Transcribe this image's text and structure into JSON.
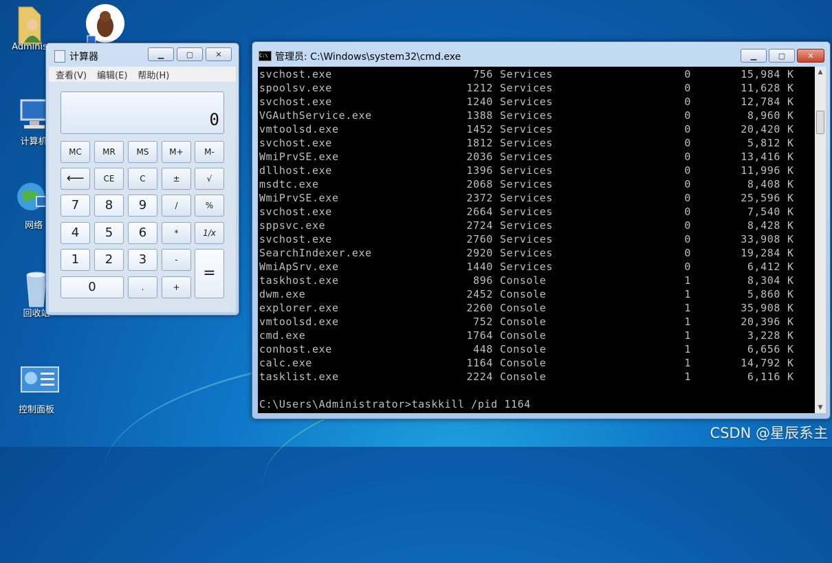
{
  "desktop": {
    "icons": [
      {
        "label": "Adminis",
        "icon": "user-folder-icon"
      },
      {
        "label": "",
        "icon": "beaver-app-icon"
      },
      {
        "label": "计算机",
        "icon": "computer-icon"
      },
      {
        "label": "网络",
        "icon": "network-icon"
      },
      {
        "label": "回收站",
        "icon": "recycle-bin-icon"
      },
      {
        "label": "控制面板",
        "icon": "control-panel-icon"
      }
    ],
    "watermark": "CSDN @星辰系主"
  },
  "calculator": {
    "title": "计算器",
    "menu": [
      "查看(V)",
      "编辑(E)",
      "帮助(H)"
    ],
    "display": "0",
    "keys": {
      "mc": "MC",
      "mr": "MR",
      "ms": "MS",
      "mplus": "M+",
      "mminus": "M-",
      "back": "⟵",
      "ce": "CE",
      "c": "C",
      "sign": "±",
      "sqrt": "√",
      "n7": "7",
      "n8": "8",
      "n9": "9",
      "div": "/",
      "pct": "%",
      "n4": "4",
      "n5": "5",
      "n6": "6",
      "mul": "*",
      "recip": "1/x",
      "n1": "1",
      "n2": "2",
      "n3": "3",
      "sub": "-",
      "eq": "=",
      "n0": "0",
      "dot": ".",
      "add": "+"
    }
  },
  "cmd": {
    "title": "管理员: C:\\Windows\\system32\\cmd.exe",
    "icon_text": "C:\\",
    "rows": [
      {
        "name": "svchost.exe",
        "pid": "756",
        "session": "Services",
        "num": "0",
        "mem": "15,984",
        "unit": "K"
      },
      {
        "name": "spoolsv.exe",
        "pid": "1212",
        "session": "Services",
        "num": "0",
        "mem": "11,628",
        "unit": "K"
      },
      {
        "name": "svchost.exe",
        "pid": "1240",
        "session": "Services",
        "num": "0",
        "mem": "12,784",
        "unit": "K"
      },
      {
        "name": "VGAuthService.exe",
        "pid": "1388",
        "session": "Services",
        "num": "0",
        "mem": "8,960",
        "unit": "K"
      },
      {
        "name": "vmtoolsd.exe",
        "pid": "1452",
        "session": "Services",
        "num": "0",
        "mem": "20,420",
        "unit": "K"
      },
      {
        "name": "svchost.exe",
        "pid": "1812",
        "session": "Services",
        "num": "0",
        "mem": "5,812",
        "unit": "K"
      },
      {
        "name": "WmiPrvSE.exe",
        "pid": "2036",
        "session": "Services",
        "num": "0",
        "mem": "13,416",
        "unit": "K"
      },
      {
        "name": "dllhost.exe",
        "pid": "1396",
        "session": "Services",
        "num": "0",
        "mem": "11,996",
        "unit": "K"
      },
      {
        "name": "msdtc.exe",
        "pid": "2068",
        "session": "Services",
        "num": "0",
        "mem": "8,408",
        "unit": "K"
      },
      {
        "name": "WmiPrvSE.exe",
        "pid": "2372",
        "session": "Services",
        "num": "0",
        "mem": "25,596",
        "unit": "K"
      },
      {
        "name": "svchost.exe",
        "pid": "2664",
        "session": "Services",
        "num": "0",
        "mem": "7,540",
        "unit": "K"
      },
      {
        "name": "sppsvc.exe",
        "pid": "2724",
        "session": "Services",
        "num": "0",
        "mem": "8,428",
        "unit": "K"
      },
      {
        "name": "svchost.exe",
        "pid": "2760",
        "session": "Services",
        "num": "0",
        "mem": "33,908",
        "unit": "K"
      },
      {
        "name": "SearchIndexer.exe",
        "pid": "2920",
        "session": "Services",
        "num": "0",
        "mem": "19,284",
        "unit": "K"
      },
      {
        "name": "WmiApSrv.exe",
        "pid": "1440",
        "session": "Services",
        "num": "0",
        "mem": "6,412",
        "unit": "K"
      },
      {
        "name": "taskhost.exe",
        "pid": "896",
        "session": "Console",
        "num": "1",
        "mem": "8,304",
        "unit": "K"
      },
      {
        "name": "dwm.exe",
        "pid": "2452",
        "session": "Console",
        "num": "1",
        "mem": "5,860",
        "unit": "K"
      },
      {
        "name": "explorer.exe",
        "pid": "2260",
        "session": "Console",
        "num": "1",
        "mem": "35,908",
        "unit": "K"
      },
      {
        "name": "vmtoolsd.exe",
        "pid": "752",
        "session": "Console",
        "num": "1",
        "mem": "20,396",
        "unit": "K"
      },
      {
        "name": "cmd.exe",
        "pid": "1764",
        "session": "Console",
        "num": "1",
        "mem": "3,228",
        "unit": "K"
      },
      {
        "name": "conhost.exe",
        "pid": "448",
        "session": "Console",
        "num": "1",
        "mem": "6,656",
        "unit": "K"
      },
      {
        "name": "calc.exe",
        "pid": "1164",
        "session": "Console",
        "num": "1",
        "mem": "14,792",
        "unit": "K"
      },
      {
        "name": "tasklist.exe",
        "pid": "2224",
        "session": "Console",
        "num": "1",
        "mem": "6,116",
        "unit": "K"
      }
    ],
    "prompt": "C:\\Users\\Administrator>taskkill /pid 1164"
  }
}
